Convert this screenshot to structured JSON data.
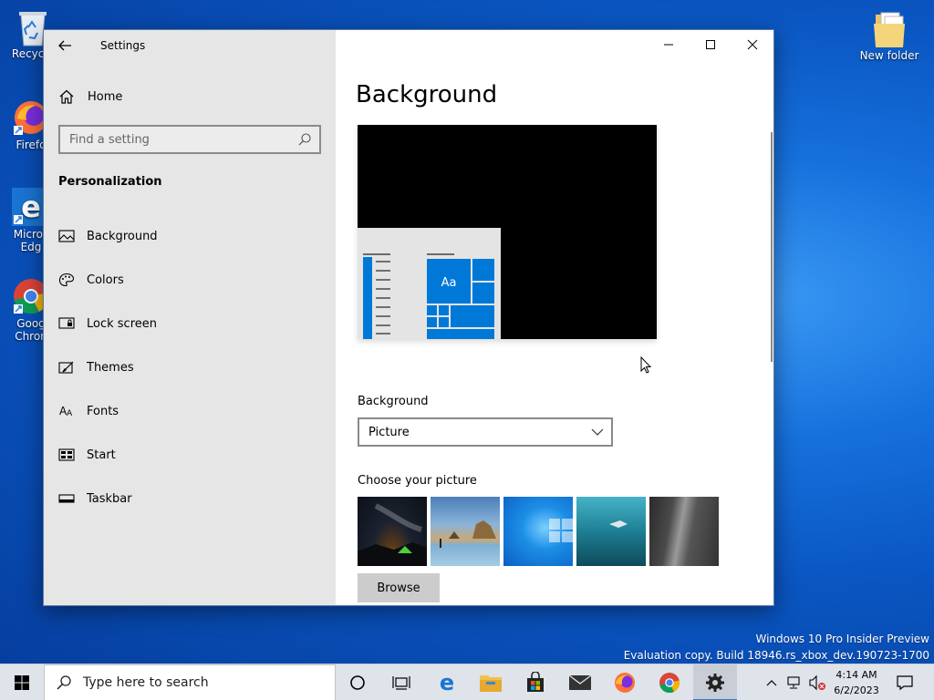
{
  "desktop": {
    "icons": [
      {
        "label": "Recycle"
      },
      {
        "label": "Firefo"
      },
      {
        "label": "Micros",
        "label2": "Edg"
      },
      {
        "label": "Goog",
        "label2": "Chron"
      },
      {
        "label": "New folder"
      }
    ],
    "watermark": {
      "line1": "Windows 10 Pro Insider Preview",
      "line2": "Evaluation copy. Build 18946.rs_xbox_dev.190723-1700"
    }
  },
  "window": {
    "title": "Settings",
    "nav": {
      "home_label": "Home",
      "search_placeholder": "Find a setting",
      "section_title": "Personalization",
      "items": [
        {
          "label": "Background",
          "icon": "picture-icon"
        },
        {
          "label": "Colors",
          "icon": "palette-icon"
        },
        {
          "label": "Lock screen",
          "icon": "lock-screen-icon"
        },
        {
          "label": "Themes",
          "icon": "brush-icon"
        },
        {
          "label": "Fonts",
          "icon": "font-icon"
        },
        {
          "label": "Start",
          "icon": "start-icon"
        },
        {
          "label": "Taskbar",
          "icon": "taskbar-icon"
        }
      ]
    },
    "main": {
      "title": "Background",
      "preview_tile_text": "Aa",
      "background_label": "Background",
      "background_value": "Picture",
      "choose_label": "Choose your picture",
      "browse_label": "Browse"
    }
  },
  "taskbar": {
    "search_placeholder": "Type here to search",
    "clock_time": "4:14 AM",
    "clock_date": "6/2/2023"
  },
  "colors": {
    "accent": "#0078d7",
    "nav_bg": "#e6e6e6",
    "desktop": "#0a56c2"
  }
}
